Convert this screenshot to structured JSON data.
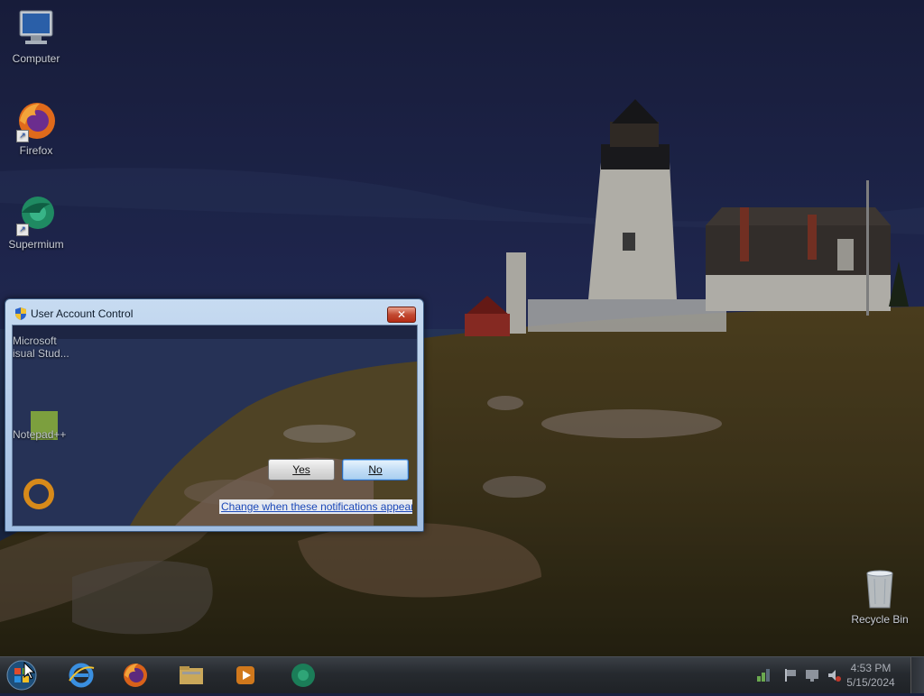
{
  "desktop": {
    "icons": [
      {
        "label": "Computer"
      },
      {
        "label": "Firefox"
      },
      {
        "label": "Supermium"
      },
      {
        "label": "Recycle Bin"
      }
    ]
  },
  "uac": {
    "title": "User Account Control",
    "yes_label": "Yes",
    "no_label": "No",
    "change_link": "Change when these notifications appear",
    "ghost_icons": [
      {
        "label": "Microsoft\nisual Stud..."
      },
      {
        "label": "Notepad++"
      }
    ]
  },
  "taskbar": {
    "time": "4:53 PM",
    "date": "5/15/2024"
  },
  "colors": {
    "link": "#1b48b8",
    "taskbar": "#262a2f",
    "dialog_frame": "#9fbde2"
  },
  "icons": [
    "computer-icon",
    "firefox-icon",
    "supermium-icon",
    "recycle-bin-icon",
    "shield-icon",
    "close-icon",
    "start-orb-icon",
    "internet-explorer-icon",
    "firefox-taskbar-icon",
    "explorer-icon",
    "media-player-icon",
    "supermium-taskbar-icon",
    "network-tray-icon",
    "flag-tray-icon",
    "display-tray-icon",
    "volume-tray-icon"
  ]
}
